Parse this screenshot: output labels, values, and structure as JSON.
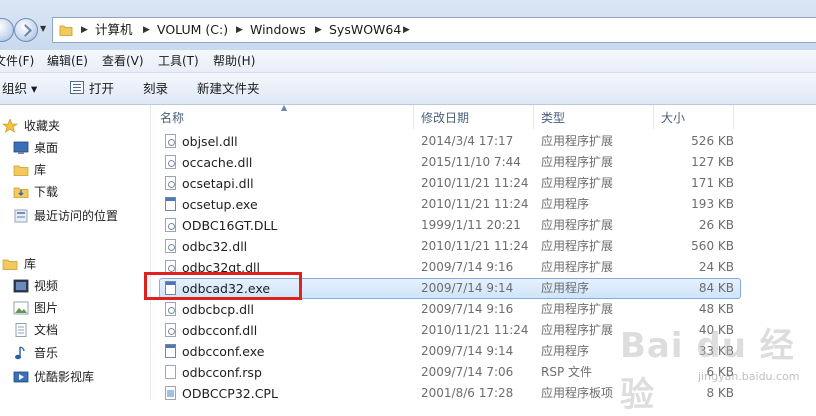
{
  "address_bar": {
    "crumbs": [
      "计算机",
      "VOLUM (C:)",
      "Windows",
      "SysWOW64"
    ]
  },
  "menu": {
    "items": [
      "文件(F)",
      "编辑(E)",
      "查看(V)",
      "工具(T)",
      "帮助(H)"
    ]
  },
  "toolbar": {
    "organize": "组织 ▾",
    "open": "打开",
    "burn": "刻录",
    "new_folder": "新建文件夹"
  },
  "nav": {
    "favorites": "收藏夹",
    "desktop": "桌面",
    "library_fav": "库",
    "downloads": "下载",
    "recent": "最近访问的位置",
    "libraries": "库",
    "videos": "视频",
    "pictures": "图片",
    "documents": "文档",
    "music": "音乐",
    "youku": "优酷影视库"
  },
  "columns": {
    "name": "名称",
    "date": "修改日期",
    "type": "类型",
    "size": "大小"
  },
  "files": [
    {
      "name": "objsel.dll",
      "date": "2014/3/4 17:17",
      "type": "应用程序扩展",
      "size": "526 KB",
      "icon": "dll"
    },
    {
      "name": "occache.dll",
      "date": "2015/11/10 7:44",
      "type": "应用程序扩展",
      "size": "127 KB",
      "icon": "dll"
    },
    {
      "name": "ocsetapi.dll",
      "date": "2010/11/21 11:24",
      "type": "应用程序扩展",
      "size": "171 KB",
      "icon": "dll"
    },
    {
      "name": "ocsetup.exe",
      "date": "2010/11/21 11:24",
      "type": "应用程序",
      "size": "193 KB",
      "icon": "exe"
    },
    {
      "name": "ODBC16GT.DLL",
      "date": "1999/1/11 20:21",
      "type": "应用程序扩展",
      "size": "26 KB",
      "icon": "dll"
    },
    {
      "name": "odbc32.dll",
      "date": "2010/11/21 11:24",
      "type": "应用程序扩展",
      "size": "560 KB",
      "icon": "dll"
    },
    {
      "name": "odbc32gt.dll",
      "date": "2009/7/14 9:16",
      "type": "应用程序扩展",
      "size": "24 KB",
      "icon": "dll"
    },
    {
      "name": "odbcad32.exe",
      "date": "2009/7/14 9:14",
      "type": "应用程序",
      "size": "84 KB",
      "icon": "exe",
      "selected": true
    },
    {
      "name": "odbcbcp.dll",
      "date": "2009/7/14 9:16",
      "type": "应用程序扩展",
      "size": "48 KB",
      "icon": "dll"
    },
    {
      "name": "odbcconf.dll",
      "date": "2010/11/21 11:24",
      "type": "应用程序扩展",
      "size": "40 KB",
      "icon": "dll"
    },
    {
      "name": "odbcconf.exe",
      "date": "2009/7/14 9:14",
      "type": "应用程序",
      "size": "33 KB",
      "icon": "exe"
    },
    {
      "name": "odbcconf.rsp",
      "date": "2009/7/14 7:06",
      "type": "RSP 文件",
      "size": "6 KB",
      "icon": "doc"
    },
    {
      "name": "ODBCCP32.CPL",
      "date": "2001/8/6 17:28",
      "type": "应用程序板项",
      "size": "8 KB",
      "icon": "cpl"
    }
  ],
  "watermark": {
    "logo": "Bai du 经验",
    "url": "jingyan.baidu.com"
  }
}
